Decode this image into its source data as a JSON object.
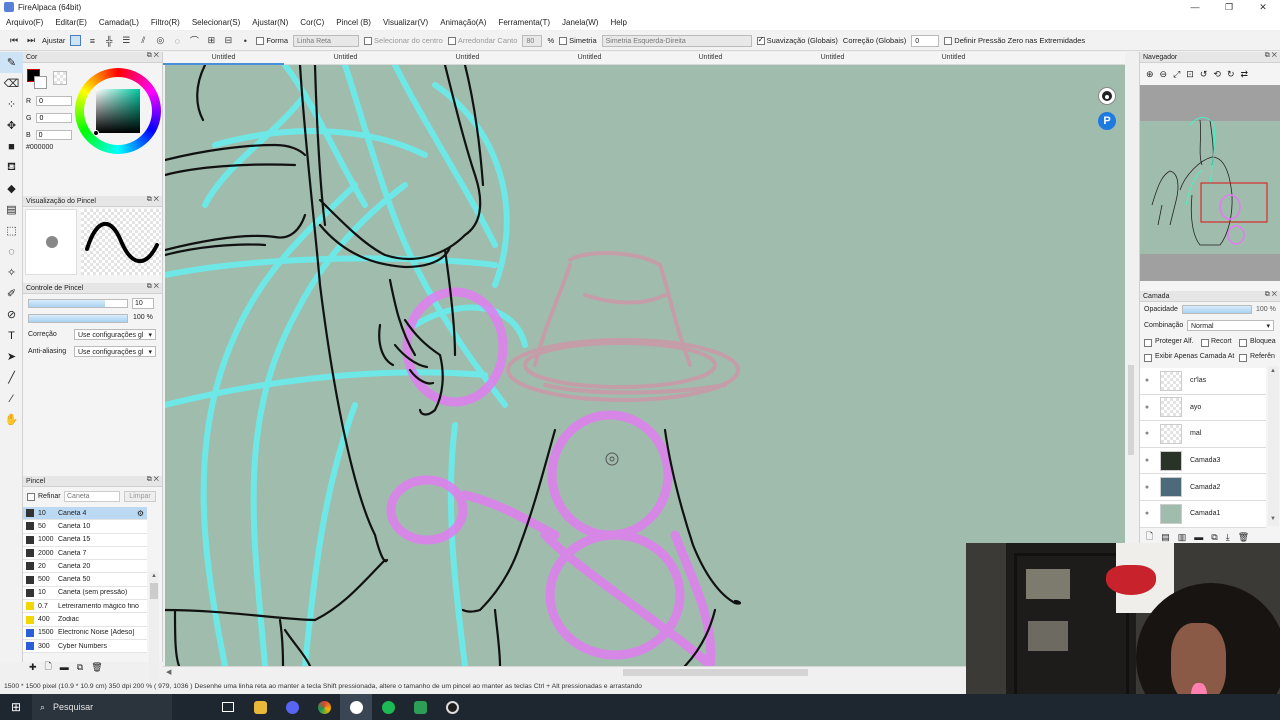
{
  "window": {
    "title": "FireAlpaca (64bit)",
    "controls": [
      "—",
      "❐",
      "✕"
    ]
  },
  "menu": [
    "Arquivo(F)",
    "Editar(E)",
    "Camada(L)",
    "Filtro(R)",
    "Selecionar(S)",
    "Ajustar(N)",
    "Cor(C)",
    "Pincel (B)",
    "Visualizar(V)",
    "Animação(A)",
    "Ferramenta(T)",
    "Janela(W)",
    "Help"
  ],
  "toolbar": {
    "adjust_label": "Ajustar",
    "forma_label": "Forma",
    "forma_value": "Linha Reta",
    "selecionar_centro_label": "Selecionar do centro",
    "arredondar_label": "Arredondar Canto",
    "arredondar_value": "80",
    "percent_sign": "%",
    "simetria_label": "Simetria",
    "simetria_value": "Simetria Esquerda-Direita",
    "suavizacao_label": "Suavização (Globais)",
    "correcao_label": "Correção (Globais)",
    "correcao_value": "0",
    "pressao_label": "Definir Pressão Zero nas Extremidades"
  },
  "color_panel": {
    "title": "Cor",
    "r_label": "R",
    "g_label": "G",
    "b_label": "B",
    "r_value": "0",
    "g_value": "0",
    "b_value": "0",
    "hex": "#000000",
    "foreground": "#000000"
  },
  "brush_preview_panel": {
    "title": "Visualização do Pincel"
  },
  "brush_control_panel": {
    "title": "Controle de Pincel",
    "size_value": "10",
    "size_fill": 0.78,
    "opacity_value": "100 %",
    "opacity_fill": 1.0,
    "correcao_label": "Correção",
    "correcao_value": "Use configurações gl",
    "antialias_label": "Anti-aliasing",
    "antialias_value": "Use configurações gl"
  },
  "brush_panel": {
    "title": "Pincel",
    "refinar_label": "Refinar",
    "caneta_placeholder": "Caneta",
    "limpar_label": "Limpar",
    "items": [
      {
        "size": "10",
        "name": "Caneta 4",
        "color": "#333333",
        "selected": true
      },
      {
        "size": "50",
        "name": "Caneta 10",
        "color": "#333333",
        "selected": false
      },
      {
        "size": "1000",
        "name": "Caneta 15",
        "color": "#333333",
        "selected": false
      },
      {
        "size": "2000",
        "name": "Caneta 7",
        "color": "#333333",
        "selected": false
      },
      {
        "size": "20",
        "name": "Caneta 20",
        "color": "#333333",
        "selected": false
      },
      {
        "size": "500",
        "name": "Caneta 50",
        "color": "#333333",
        "selected": false
      },
      {
        "size": "10",
        "name": "Caneta (sem pressão)",
        "color": "#333333",
        "selected": false
      },
      {
        "size": "0.7",
        "name": "Letreiramento mágico fino",
        "color": "#f0d800",
        "selected": false
      },
      {
        "size": "400",
        "name": "Zodiac",
        "color": "#f0d800",
        "selected": false
      },
      {
        "size": "1500",
        "name": "Electronic Noise [Adeso]",
        "color": "#2b5fd6",
        "selected": false
      },
      {
        "size": "300",
        "name": "Cyber Numbers",
        "color": "#2b5fd6",
        "selected": false
      }
    ]
  },
  "tabs": [
    "Untitled",
    "Untitled",
    "Untitled",
    "Untitled",
    "Untitled",
    "Untitled",
    "Untitled"
  ],
  "navigator": {
    "title": "Navegador"
  },
  "layer_panel": {
    "title": "Camada",
    "opacity_label": "Opacidade",
    "opacity_value": "100 %",
    "opacity_fill": 1.0,
    "blend_label": "Combinação",
    "blend_value": "Normal",
    "protect_alpha_label": "Proteger Alf.",
    "clip_label": "Recort",
    "lock_label": "Bloquea",
    "show_only_label": "Exibir Apenas Camada At",
    "reference_label": "Referên",
    "layers": [
      {
        "name": "cr'las",
        "thumb": "checker"
      },
      {
        "name": "ayo",
        "thumb": "checker"
      },
      {
        "name": "mal",
        "thumb": "checker"
      },
      {
        "name": "Camada3",
        "thumb": "#2a3328"
      },
      {
        "name": "Camada2",
        "thumb": "#4c6a7a"
      },
      {
        "name": "Camada1",
        "thumb": "#a0bcad"
      }
    ]
  },
  "statusbar": {
    "text": "1500 * 1500 pixel  (10.9 * 10.9 cm)  350 dpi  200 %  ( 979, 1036 )  Desenhe uma linha reta ao manter a tecla Shift pressionada, altere o tamanho de um pincel ao manter as teclas Ctrl + Alt pressionadas e arrastando"
  },
  "taskbar": {
    "search_label": "Pesquisar"
  },
  "colors": {
    "canvas": "#a0bcad",
    "accent": "#cfe3f7",
    "stroke_black": "#111111",
    "stroke_cyan": "#66f0f0",
    "stroke_pink": "#e07ef0",
    "stroke_rose": "#c99aa8"
  }
}
